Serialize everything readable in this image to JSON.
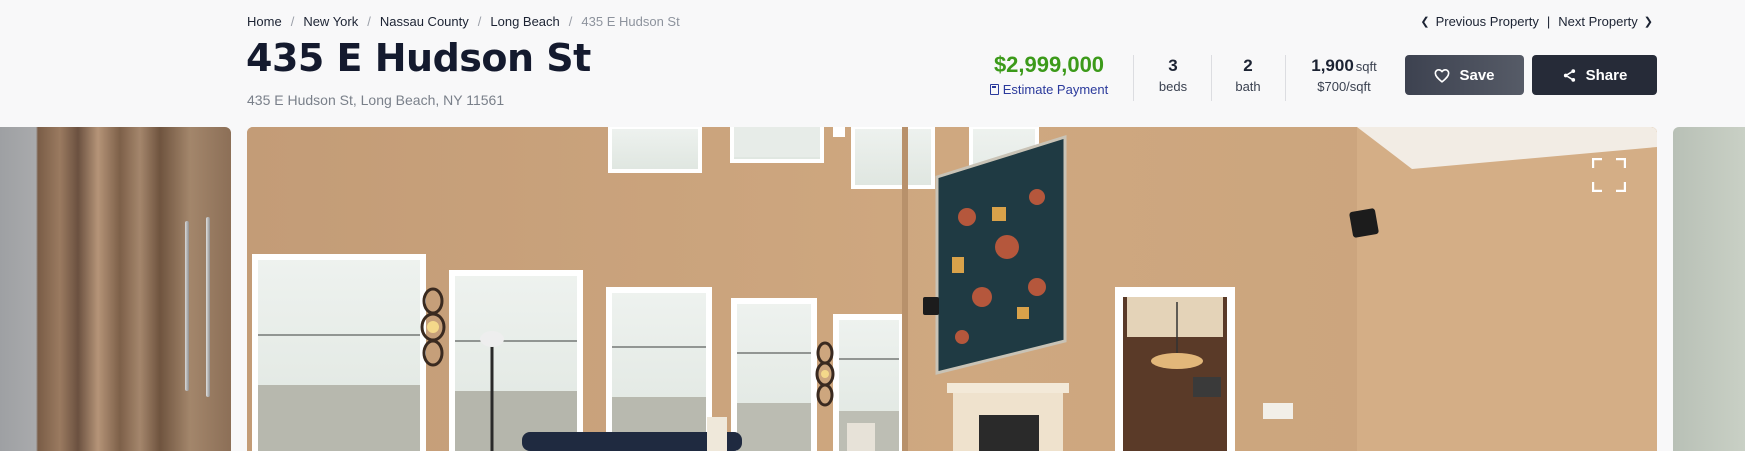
{
  "breadcrumb": {
    "items": [
      "Home",
      "New York",
      "Nassau County",
      "Long Beach"
    ],
    "current": "435 E Hudson St",
    "separator": "/"
  },
  "property_nav": {
    "previous_label": "Previous Property",
    "next_label": "Next Property",
    "divider": "|"
  },
  "listing": {
    "title": "435 E Hudson St",
    "address": "435 E Hudson St, Long Beach, NY 11561",
    "price": "$2,999,000",
    "estimate_label": "Estimate Payment",
    "beds_value": "3",
    "beds_label": "beds",
    "bath_value": "2",
    "bath_label": "bath",
    "sqft_value": "1,900",
    "sqft_unit": "sqft",
    "price_per_sqft": "$700/sqft"
  },
  "actions": {
    "save_label": "Save",
    "share_label": "Share"
  },
  "colors": {
    "price": "#3c9a1a",
    "link": "#2b3a9c",
    "title": "#141a2e",
    "button_dark": "#262b38"
  },
  "icons": {
    "save": "heart-icon",
    "share": "share-icon",
    "estimate": "calculator-icon",
    "gallery": "fullscreen-icon"
  }
}
